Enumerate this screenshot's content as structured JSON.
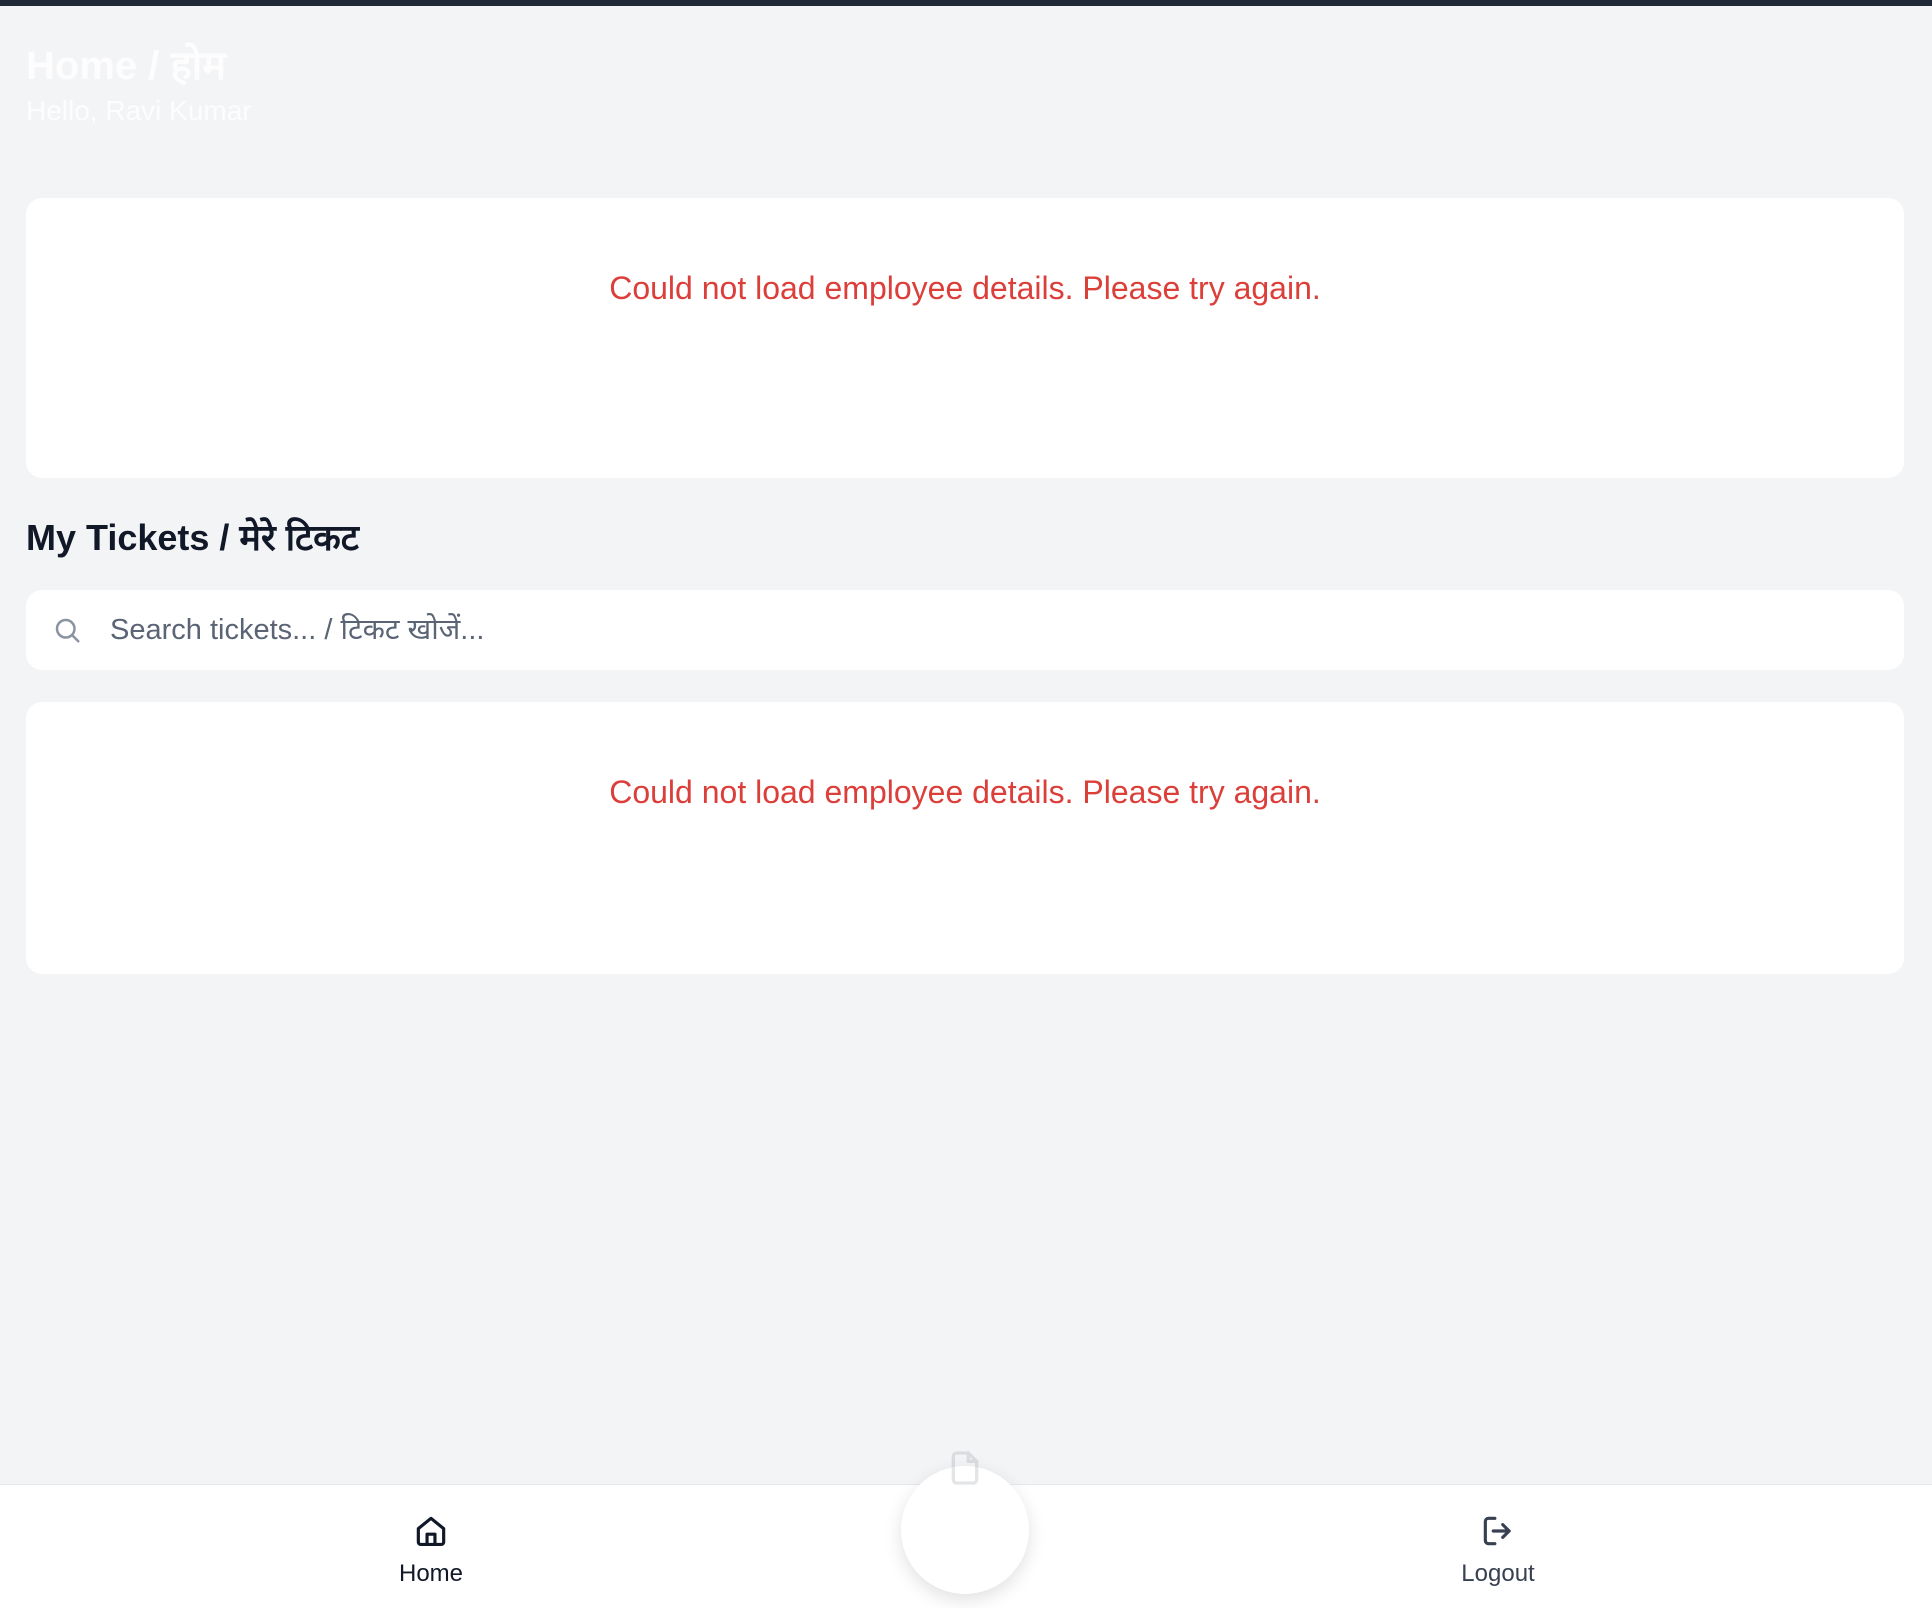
{
  "header": {
    "title": "Home / होम",
    "greeting": "Hello, Ravi Kumar"
  },
  "employee_card": {
    "error": "Could not load employee details. Please try again."
  },
  "tickets": {
    "section_title": "My Tickets / मेरे टिकट",
    "search_placeholder": "Search tickets... / टिकट खोजें...",
    "search_value": "",
    "error": "Could not load employee details. Please try again."
  },
  "bottom_nav": {
    "home_label": "Home",
    "logout_label": "Logout"
  },
  "icons": {
    "search": "search-icon",
    "home": "home-icon",
    "logout": "logout-icon",
    "new_ticket": "document-icon"
  },
  "colors": {
    "background": "#f3f4f6",
    "error": "#dc3f3a",
    "card": "#ffffff",
    "top_strip": "#1f2937"
  }
}
